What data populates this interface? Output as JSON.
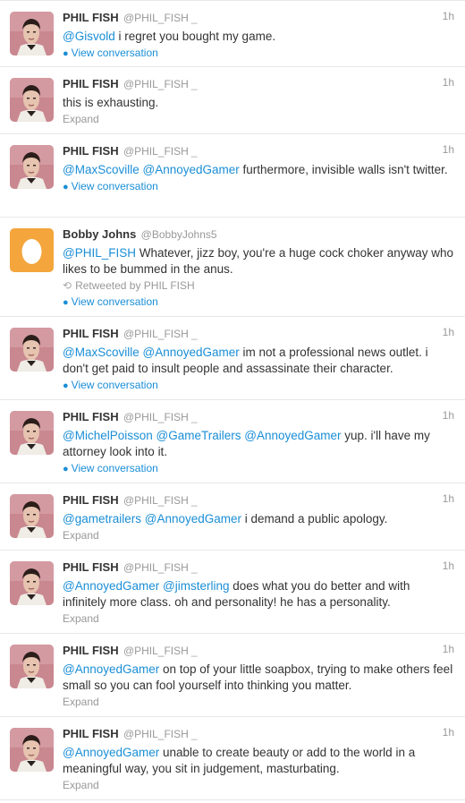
{
  "tweets": [
    {
      "name": "PHIL FISH",
      "handle": "@PHIL_FISH",
      "badge": "_",
      "time": "1h",
      "avatar": "phil",
      "height": 75,
      "segments": [
        [
          "mention",
          "@Gisvold"
        ],
        [
          "text",
          " i regret you bought my game."
        ]
      ],
      "retweeted_by": "",
      "action": "View conversation",
      "action_type": "conversation"
    },
    {
      "name": "PHIL FISH",
      "handle": "@PHIL_FISH",
      "badge": "_",
      "time": "1h",
      "avatar": "phil",
      "height": 75,
      "segments": [
        [
          "text",
          "this is exhausting."
        ]
      ],
      "retweeted_by": "",
      "action": "Expand",
      "action_type": "expand"
    },
    {
      "name": "PHIL FISH",
      "handle": "@PHIL_FISH",
      "badge": "_",
      "time": "1h",
      "avatar": "phil",
      "height": 93,
      "segments": [
        [
          "mention",
          "@MaxScoville"
        ],
        [
          "text",
          " "
        ],
        [
          "mention",
          "@AnnoyedGamer"
        ],
        [
          "text",
          " furthermore, invisible walls isn't twitter."
        ]
      ],
      "retweeted_by": "",
      "action": "View conversation",
      "action_type": "conversation"
    },
    {
      "name": "Bobby Johns",
      "handle": "@BobbyJohns5",
      "badge": "",
      "time": "",
      "avatar": "egg",
      "height": 111,
      "segments": [
        [
          "mention",
          "@PHIL_FISH"
        ],
        [
          "text",
          " Whatever, jizz boy, you're a huge cock choker anyway who likes to be bummed in the anus."
        ]
      ],
      "retweeted_by": "Retweeted by PHIL FISH",
      "action": "View conversation",
      "action_type": "conversation"
    },
    {
      "name": "PHIL FISH",
      "handle": "@PHIL_FISH",
      "badge": "_",
      "time": "1h",
      "avatar": "phil",
      "height": 93,
      "segments": [
        [
          "mention",
          "@MaxScoville"
        ],
        [
          "text",
          " "
        ],
        [
          "mention",
          "@AnnoyedGamer"
        ],
        [
          "text",
          " im not a professional news outlet. i don't get paid to insult people and assassinate their character."
        ]
      ],
      "retweeted_by": "",
      "action": "View conversation",
      "action_type": "conversation"
    },
    {
      "name": "PHIL FISH",
      "handle": "@PHIL_FISH",
      "badge": "_",
      "time": "1h",
      "avatar": "phil",
      "height": 93,
      "segments": [
        [
          "mention",
          "@MichelPoisson"
        ],
        [
          "text",
          " "
        ],
        [
          "mention",
          "@GameTrailers"
        ],
        [
          "text",
          " "
        ],
        [
          "mention",
          "@AnnoyedGamer"
        ],
        [
          "text",
          " yup. i'll have my attorney look into it."
        ]
      ],
      "retweeted_by": "",
      "action": "View conversation",
      "action_type": "conversation"
    },
    {
      "name": "PHIL FISH",
      "handle": "@PHIL_FISH",
      "badge": "_",
      "time": "1h",
      "avatar": "phil",
      "height": 75,
      "segments": [
        [
          "mention",
          "@gametrailers"
        ],
        [
          "text",
          " "
        ],
        [
          "mention",
          "@AnnoyedGamer"
        ],
        [
          "text",
          " i demand a public apology."
        ]
      ],
      "retweeted_by": "",
      "action": "Expand",
      "action_type": "expand"
    },
    {
      "name": "PHIL FISH",
      "handle": "@PHIL_FISH",
      "badge": "_",
      "time": "1h",
      "avatar": "phil",
      "height": 93,
      "segments": [
        [
          "mention",
          "@AnnoyedGamer"
        ],
        [
          "text",
          " "
        ],
        [
          "mention",
          "@jimsterling"
        ],
        [
          "text",
          " does what you do better and with infinitely more class. oh and personality! he has a personality."
        ]
      ],
      "retweeted_by": "",
      "action": "Expand",
      "action_type": "expand"
    },
    {
      "name": "PHIL FISH",
      "handle": "@PHIL_FISH",
      "badge": "_",
      "time": "1h",
      "avatar": "phil",
      "height": 93,
      "segments": [
        [
          "mention",
          "@AnnoyedGamer"
        ],
        [
          "text",
          " on top of your little soapbox, trying to make others feel small so you can fool yourself into thinking you matter."
        ]
      ],
      "retweeted_by": "",
      "action": "Expand",
      "action_type": "expand"
    },
    {
      "name": "PHIL FISH",
      "handle": "@PHIL_FISH",
      "badge": "_",
      "time": "1h",
      "avatar": "phil",
      "height": 93,
      "segments": [
        [
          "mention",
          "@AnnoyedGamer"
        ],
        [
          "text",
          " unable to create beauty or add to the world in a meaningful way, you sit in judgement, masturbating."
        ]
      ],
      "retweeted_by": "",
      "action": "Expand",
      "action_type": "expand"
    }
  ],
  "colors": {
    "link": "#1a8ed6",
    "muted": "#999999",
    "text": "#333333",
    "divider": "#e8e8e8"
  }
}
